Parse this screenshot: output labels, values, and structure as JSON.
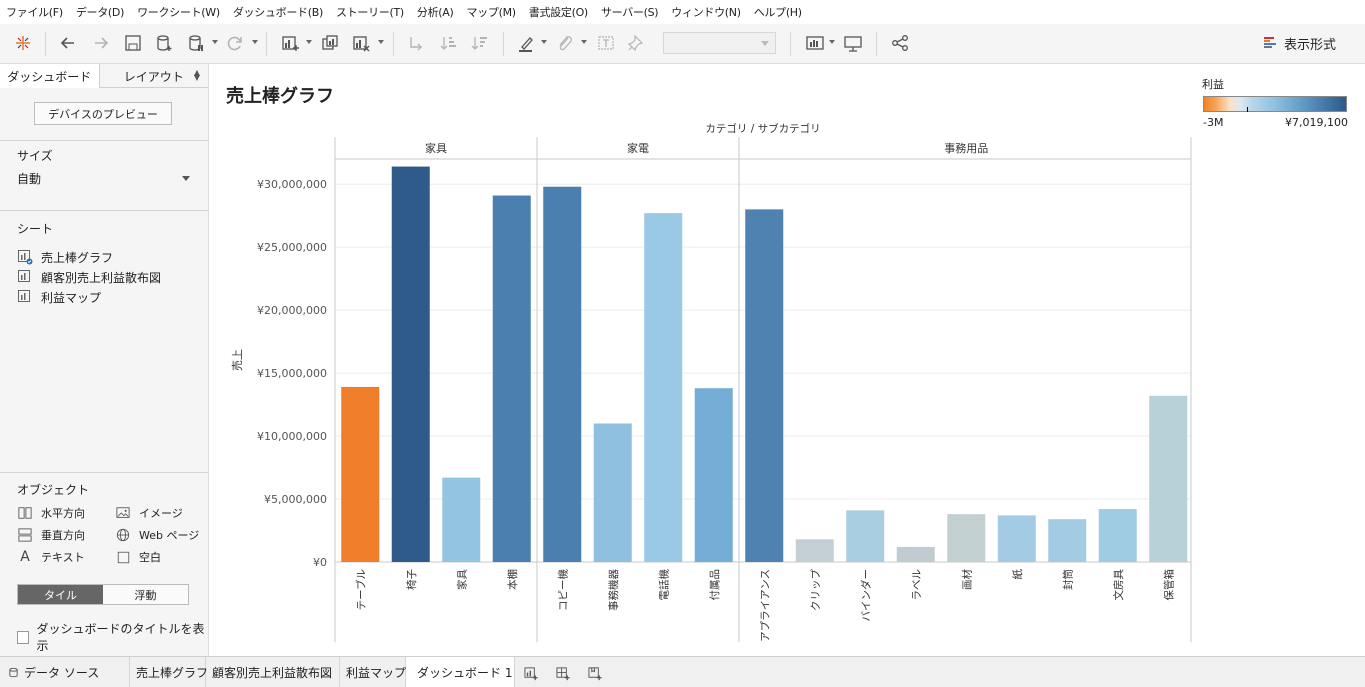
{
  "menu": [
    "ファイル(F)",
    "データ(D)",
    "ワークシート(W)",
    "ダッシュボード(B)",
    "ストーリー(T)",
    "分析(A)",
    "マップ(M)",
    "書式設定(O)",
    "サーバー(S)",
    "ウィンドウ(N)",
    "ヘルプ(H)"
  ],
  "toolbar": {
    "show_me_label": "表示形式",
    "icons": [
      "tableau-logo-icon",
      "undo-icon",
      "redo-icon",
      "save-icon",
      "new-datasource-icon",
      "pause-updates-icon",
      "refresh-icon",
      "new-worksheet-icon",
      "duplicate-icon",
      "clear-sheet-icon",
      "swap-icon",
      "sort-ascending-icon",
      "sort-descending-icon",
      "highlight-icon",
      "group-icon",
      "label-icon",
      "pin-icon",
      "fit-dropdown",
      "show-cards-icon",
      "presentation-icon",
      "share-icon"
    ]
  },
  "left_panel": {
    "tabs": {
      "dashboard": "ダッシュボード",
      "layout": "レイアウト"
    },
    "device_preview": "デバイスのプレビュー",
    "size_title": "サイズ",
    "size_value": "自動",
    "sheets_title": "シート",
    "sheets": [
      "売上棒グラフ",
      "顧客別売上利益散布図",
      "利益マップ"
    ],
    "objects_title": "オブジェクト",
    "objects": {
      "horizontal": "水平方向",
      "image": "イメージ",
      "vertical": "垂直方向",
      "web_page": "Web ページ",
      "text": "テキスト",
      "blank": "空白"
    },
    "tile": "タイル",
    "floating": "浮動",
    "show_title": "ダッシュボードのタイトルを表示"
  },
  "canvas": {
    "sheet_title": "売上棒グラフ"
  },
  "legend": {
    "title": "利益",
    "min_label": "-3M",
    "max_label": "¥7,019,100",
    "colors": {
      "low": "#f08127",
      "high": "#2d5a88"
    }
  },
  "chart_data": {
    "type": "bar",
    "column_header": "カテゴリ / サブカテゴリ",
    "ylabel": "売上",
    "ylim": [
      0,
      32000000
    ],
    "yticks": [
      0,
      5000000,
      10000000,
      15000000,
      20000000,
      25000000,
      30000000
    ],
    "ytick_labels": [
      "¥0",
      "¥5,000,000",
      "¥10,000,000",
      "¥15,000,000",
      "¥20,000,000",
      "¥25,000,000",
      "¥30,000,000"
    ],
    "grid": true,
    "groups": [
      {
        "name": "家具",
        "bars": [
          {
            "label": "テーブル",
            "value": 13900000,
            "color": "#ef7d29"
          },
          {
            "label": "椅子",
            "value": 31400000,
            "color": "#2e5b8a"
          },
          {
            "label": "家具",
            "value": 6700000,
            "color": "#93c5e3"
          },
          {
            "label": "本棚",
            "value": 29100000,
            "color": "#4b7fb0"
          }
        ]
      },
      {
        "name": "家電",
        "bars": [
          {
            "label": "コピー機",
            "value": 29800000,
            "color": "#4b7fb0"
          },
          {
            "label": "事務機器",
            "value": 11000000,
            "color": "#8fc0e0"
          },
          {
            "label": "電話機",
            "value": 27700000,
            "color": "#9ac9e5"
          },
          {
            "label": "付属品",
            "value": 13800000,
            "color": "#74add5"
          }
        ]
      },
      {
        "name": "事務用品",
        "bars": [
          {
            "label": "アプライアンス",
            "value": 28000000,
            "color": "#4f81b1"
          },
          {
            "label": "クリップ",
            "value": 1800000,
            "color": "#c3cfd3"
          },
          {
            "label": "バインダー",
            "value": 4100000,
            "color": "#a9cde1"
          },
          {
            "label": "ラベル",
            "value": 1200000,
            "color": "#c0ccd0"
          },
          {
            "label": "画材",
            "value": 3800000,
            "color": "#c3d0d2"
          },
          {
            "label": "紙",
            "value": 3700000,
            "color": "#a3cce4"
          },
          {
            "label": "封筒",
            "value": 3400000,
            "color": "#a3cce4"
          },
          {
            "label": "文房具",
            "value": 4200000,
            "color": "#9fcbe3"
          },
          {
            "label": "保管箱",
            "value": 13200000,
            "color": "#b8d0d8"
          }
        ]
      }
    ]
  },
  "bottom_tabs": {
    "datasource": "データ ソース",
    "sheet1": "売上棒グラフ",
    "sheet2": "顧客別売上利益散布図",
    "sheet3": "利益マップ",
    "dashboard": "ダッシュボード 1"
  }
}
